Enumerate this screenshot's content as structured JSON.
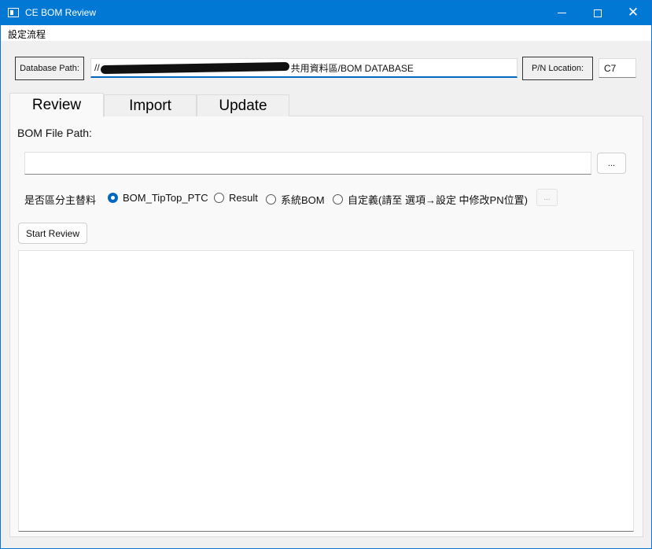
{
  "window": {
    "title": "CE BOM Review",
    "close_glyph": "✕"
  },
  "menu": {
    "items": [
      "設定流程"
    ]
  },
  "database": {
    "label": "Database Path:",
    "value_prefix": "//",
    "value_suffix": "共用資料區/BOM DATABASE"
  },
  "pn_location": {
    "label": "P/N Location:",
    "value": "C7"
  },
  "tabs": [
    {
      "label": "Review",
      "selected": true
    },
    {
      "label": "Import",
      "selected": false
    },
    {
      "label": "Update",
      "selected": false
    }
  ],
  "review": {
    "bom_file_label": "BOM File Path:",
    "bom_file_value": "",
    "browse_label": "...",
    "split_label": "是否區分主替料",
    "options": [
      {
        "label": "BOM_TipTop_PTC",
        "checked": true
      },
      {
        "label": "Result",
        "checked": false
      },
      {
        "label": "系統BOM",
        "checked": false
      },
      {
        "label": "自定義(請至 選項→設定 中修改PN位置)",
        "checked": false
      }
    ],
    "custom_button_label": "...",
    "start_button_label": "Start Review",
    "output": ""
  }
}
